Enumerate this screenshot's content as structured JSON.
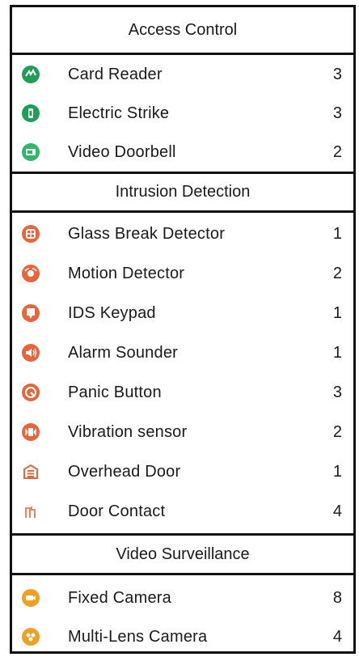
{
  "sections": [
    {
      "title": "Access Control",
      "items": [
        {
          "label": "Card Reader",
          "count": "3",
          "icon": "card-reader-icon",
          "color": "#1f9e55"
        },
        {
          "label": "Electric Strike",
          "count": "3",
          "icon": "electric-strike-icon",
          "color": "#1f9e55"
        },
        {
          "label": "Video Doorbell",
          "count": "2",
          "icon": "video-doorbell-icon",
          "color": "#2fb86a"
        }
      ]
    },
    {
      "title": "Intrusion Detection",
      "items": [
        {
          "label": "Glass Break Detector",
          "count": "1",
          "icon": "glass-break-icon",
          "color": "#e8643a"
        },
        {
          "label": "Motion Detector",
          "count": "2",
          "icon": "motion-detector-icon",
          "color": "#e8643a"
        },
        {
          "label": "IDS Keypad",
          "count": "1",
          "icon": "ids-keypad-icon",
          "color": "#e8643a"
        },
        {
          "label": "Alarm Sounder",
          "count": "1",
          "icon": "alarm-sounder-icon",
          "color": "#e8643a"
        },
        {
          "label": "Panic Button",
          "count": "3",
          "icon": "panic-button-icon",
          "color": "#e8643a"
        },
        {
          "label": "Vibration sensor",
          "count": "2",
          "icon": "vibration-sensor-icon",
          "color": "#e8643a"
        },
        {
          "label": "Overhead Door",
          "count": "1",
          "icon": "overhead-door-icon",
          "color": "#e8643a"
        },
        {
          "label": "Door Contact",
          "count": "4",
          "icon": "door-contact-icon",
          "color": "#e8643a"
        }
      ]
    },
    {
      "title": "Video Surveillance",
      "items": [
        {
          "label": "Fixed Camera",
          "count": "8",
          "icon": "fixed-camera-icon",
          "color": "#f0a020"
        },
        {
          "label": "Multi-Lens Camera",
          "count": "4",
          "icon": "multi-lens-camera-icon",
          "color": "#f0a020"
        }
      ]
    }
  ]
}
